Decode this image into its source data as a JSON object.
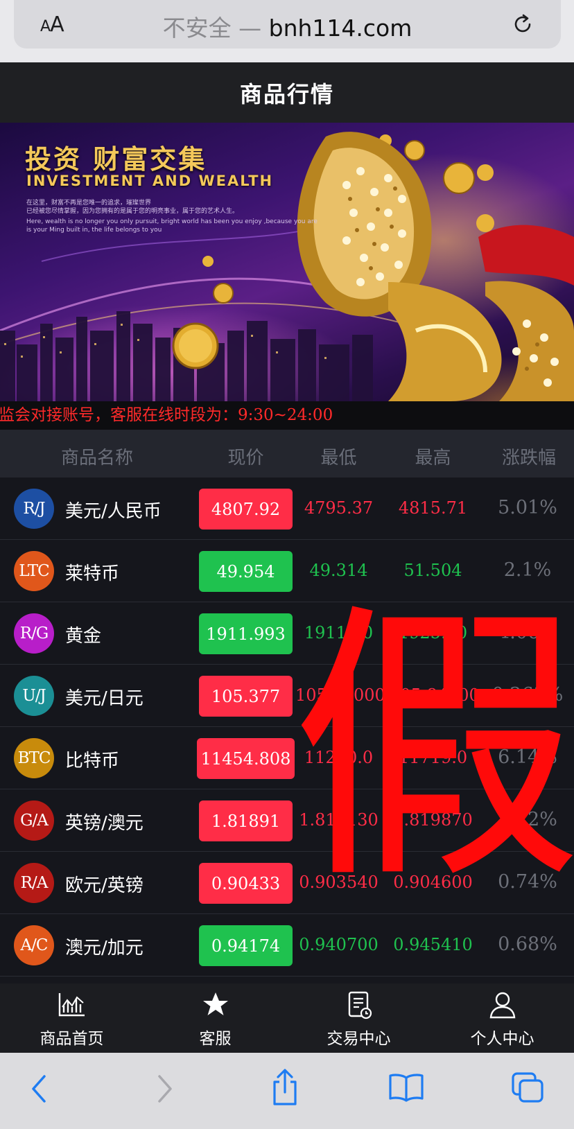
{
  "browser": {
    "aa_label_small": "A",
    "aa_label_large": "A",
    "insecure_label": "不安全 —",
    "domain": "bnh114.com"
  },
  "header": {
    "title": "商品行情"
  },
  "banner": {
    "title": "投资 财富交集",
    "subtitle": "INVESTMENT AND WEALTH",
    "line1": "在这里，财富不再是您唯一的追求，璀璨世界",
    "line2": "已经被您尽情掌握，因为您拥有的是属于您的明亮事业，属于您的艺术人生。",
    "line3": "Here, wealth is no longer you only pursuit, bright world has been you enjoy ,because you are",
    "line4": "is your Ming built in, the life belongs to you"
  },
  "marquee": {
    "text": "监会对接账号，客服在线时段为：9:30~24:00"
  },
  "table": {
    "headers": [
      "商品名称",
      "现价",
      "最低",
      "最高",
      "涨跌幅"
    ],
    "rows": [
      {
        "code": "R/J",
        "name": "美元/人民币",
        "price": "4807.92",
        "low": "4795.37",
        "high": "4815.71",
        "change": "5.01%",
        "dir": "up",
        "coin_color": "#1d4fa3"
      },
      {
        "code": "LTC",
        "name": "莱特币",
        "price": "49.954",
        "low": "49.314",
        "high": "51.504",
        "change": "2.1%",
        "dir": "down",
        "coin_color": "#e0571b"
      },
      {
        "code": "R/G",
        "name": "黄金",
        "price": "1911.993",
        "low": "1911.10",
        "high": "1925.60",
        "change": "4.06%",
        "dir": "down",
        "coin_color": "#b81ec9"
      },
      {
        "code": "U/J",
        "name": "美元/日元",
        "price": "105.377",
        "low": "105.37000",
        "high": "105.84000",
        "change": "0.263%",
        "dir": "up",
        "coin_color": "#1b8f95"
      },
      {
        "code": "BTC",
        "name": "比特币",
        "price": "11454.808",
        "low": "11270.0",
        "high": "11719.0",
        "change": "6.14%",
        "dir": "up",
        "coin_color": "#c88b0c"
      },
      {
        "code": "G/A",
        "name": "英镑/澳元",
        "price": "1.81891",
        "low": "1.811130",
        "high": "1.819870",
        "change": "3.22%",
        "dir": "up",
        "coin_color": "#b51a16"
      },
      {
        "code": "R/A",
        "name": "欧元/英镑",
        "price": "0.90433",
        "low": "0.903540",
        "high": "0.904600",
        "change": "0.74%",
        "dir": "up",
        "coin_color": "#b51a16"
      },
      {
        "code": "A/C",
        "name": "澳元/加元",
        "price": "0.94174",
        "low": "0.940700",
        "high": "0.945410",
        "change": "0.68%",
        "dir": "down",
        "coin_color": "#e0571b"
      }
    ]
  },
  "stamp": {
    "text": "假"
  },
  "tabs": [
    {
      "label": "商品首页",
      "icon": "chart-icon"
    },
    {
      "label": "客服",
      "icon": "star-icon"
    },
    {
      "label": "交易中心",
      "icon": "document-icon"
    },
    {
      "label": "个人中心",
      "icon": "person-icon"
    }
  ],
  "colors": {
    "up": "#ff2d47",
    "down": "#1fc24f",
    "marquee": "#ff2a2a",
    "ios_blue": "#1e7cf2"
  }
}
